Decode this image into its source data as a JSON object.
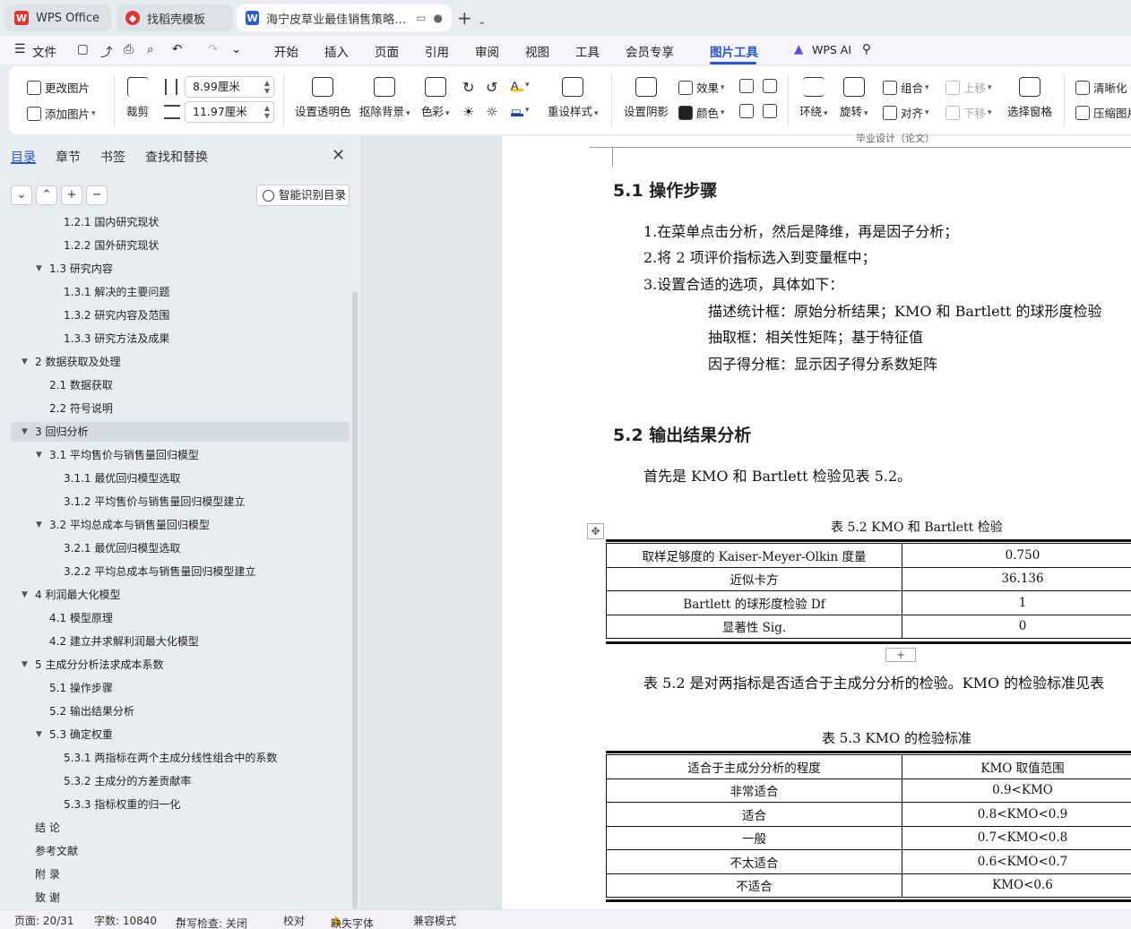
{
  "tabs": [
    {
      "title": "WPS Office"
    },
    {
      "title": "找稻壳模板"
    },
    {
      "title": "海宁皮草业最佳销售策略数学"
    }
  ],
  "menu": {
    "file": "文件",
    "items": [
      "开始",
      "插入",
      "页面",
      "引用",
      "审阅",
      "视图",
      "工具",
      "会员专享",
      "图片工具"
    ],
    "ai": "WPS AI"
  },
  "ribbon": {
    "change_image": "更改图片",
    "add_image": "添加图片",
    "crop": "裁剪",
    "width": "8.99厘米",
    "height": "11.97厘米",
    "set_transparent": "设置透明色",
    "remove_bg": "抠除背景",
    "color": "色彩",
    "reset_style": "重设样式",
    "set_shadow": "设置阴影",
    "effect": "效果",
    "fill_color": "颜色",
    "wrap": "环绕",
    "rotate": "旋转",
    "group": "组合",
    "align": "对齐",
    "move_up": "上移",
    "move_down": "下移",
    "selection_pane": "选择窗格",
    "sharpen": "清晰化",
    "compress": "压缩图片"
  },
  "nav": {
    "tabs": [
      "目录",
      "章节",
      "书签",
      "查找和替换"
    ],
    "smart_button": "智能识别目录",
    "toc": [
      "1.2.1  国内研究现状",
      "1.2.2  国外研究现状",
      "1.3  研究内容",
      "1.3.1  解决的主要问题",
      "1.3.2  研究内容及范围",
      "1.3.3  研究方法及成果",
      "2  数据获取及处理",
      "2.1  数据获取",
      "2.2  符号说明",
      "3  回归分析",
      "3.1  平均售价与销售量回归模型",
      "3.1.1  最优回归模型选取",
      "3.1.2 平均售价与销售量回归模型建立",
      "3.2 平均总成本与销售量回归模型",
      "3.2.1 最优回归模型选取",
      "3.2.2 平均总成本与销售量回归模型建立",
      "4  利润最大化模型",
      "4.1  模型原理",
      "4.2  建立并求解利润最大化模型",
      "5  主成分分析法求成本系数",
      "5.1  操作步骤",
      "5.2  输出结果分析",
      "5.3  确定权重",
      "5.3.1  两指标在两个主成分线性组合中的系数",
      "5.3.2  主成分的方差贡献率",
      "5.3.3  指标权重的归一化",
      "结  论",
      "参考文献",
      "附  录",
      "致  谢"
    ]
  },
  "doc": {
    "header": "毕业设计（论文）",
    "h_51": "5.1  操作步骤",
    "step1": "1.在菜单点击分析，然后是降维，再是因子分析；",
    "step2": "2.将 2 项评价指标选入到变量框中；",
    "step3": "3.设置合适的选项，具体如下：",
    "opt1": "描述统计框：原始分析结果；KMO 和 Bartlett 的球形度检验",
    "opt2": "抽取框：相关性矩阵；基于特征值",
    "opt3": "因子得分框：显示因子得分系数矩阵",
    "h_52": "5.2  输出结果分析",
    "intro": "首先是 KMO 和 Bartlett 检验见表 5.2。",
    "cap52": "表 5.2 KMO 和 Bartlett 检验",
    "table52": [
      [
        "取样足够度的 Kaiser-Meyer-Olkin 度量",
        "0.750"
      ],
      [
        "近似卡方",
        "36.136"
      ],
      [
        "Bartlett  的球形度检验  Df",
        "1"
      ],
      [
        "显著性 Sig.",
        "0"
      ]
    ],
    "after52": "表 5.2 是对两指标是否适合于主成分分析的检验。KMO 的检验标准见表",
    "cap53": "表 5.3 KMO 的检验标准",
    "table53_header": [
      "适合于主成分分析的程度",
      "KMO 取值范围"
    ],
    "table53": [
      [
        "非常适合",
        "0.9<KMO"
      ],
      [
        "适合",
        "0.8<KMO<0.9"
      ],
      [
        "一般",
        "0.7<KMO<0.8"
      ],
      [
        "不太适合",
        "0.6<KMO<0.7"
      ],
      [
        "不适合",
        "KMO<0.6"
      ]
    ]
  },
  "status": {
    "page": "页面: 20/31",
    "words": "字数: 10840",
    "spell": "拼写检查: 关闭",
    "proof": "校对",
    "missing_font": "缺失字体",
    "compat": "兼容模式"
  }
}
